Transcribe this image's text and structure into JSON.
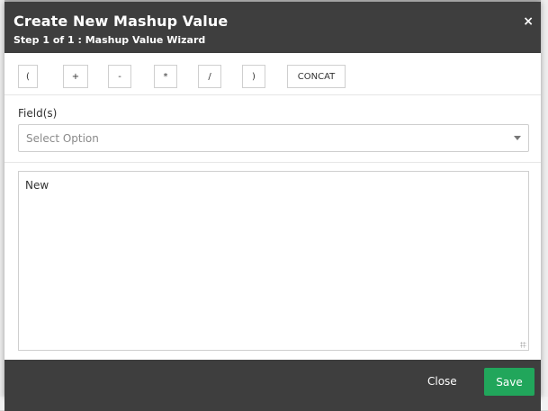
{
  "modal": {
    "title": "Create New Mashup Value",
    "subtitle": "Step 1 of 1 : Mashup Value Wizard",
    "close_icon": "×"
  },
  "toolbar": {
    "buttons": [
      {
        "label": "("
      },
      {
        "label": "+"
      },
      {
        "label": "-"
      },
      {
        "label": "*"
      },
      {
        "label": "/"
      },
      {
        "label": ")"
      },
      {
        "label": "CONCAT"
      }
    ]
  },
  "fields": {
    "label": "Field(s)",
    "placeholder": "Select Option"
  },
  "expression": {
    "value": "New"
  },
  "footer": {
    "close_label": "Close",
    "save_label": "Save"
  },
  "colors": {
    "header_bg": "#3e3e3e",
    "save_green": "#21a65b"
  }
}
